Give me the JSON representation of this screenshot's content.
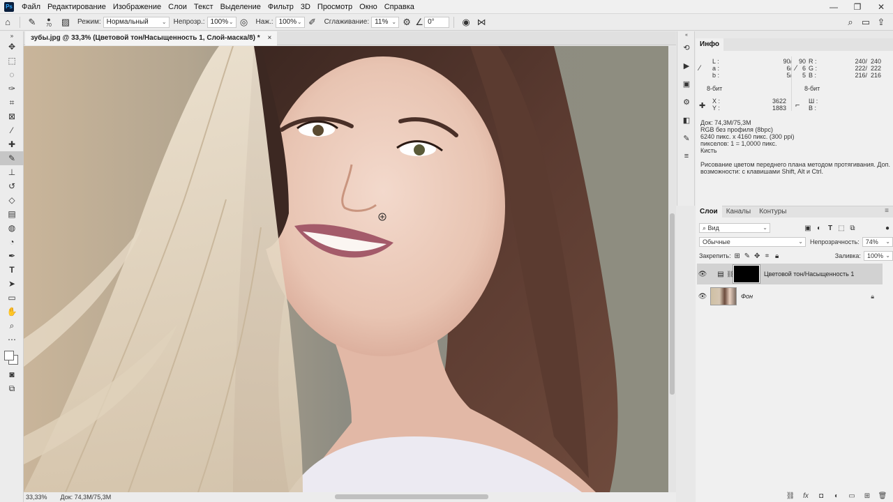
{
  "menubar": {
    "logo": "Ps",
    "items": [
      "Файл",
      "Редактирование",
      "Изображение",
      "Слои",
      "Текст",
      "Выделение",
      "Фильтр",
      "3D",
      "Просмотр",
      "Окно",
      "Справка"
    ],
    "window_controls": [
      "—",
      "❐",
      "✕"
    ]
  },
  "options": {
    "brush_size": "70",
    "mode_label": "Режим:",
    "mode_value": "Нормальный",
    "opacity_label": "Непрозр.:",
    "opacity_value": "100%",
    "pressure_label": "Наж.:",
    "pressure_value": "100%",
    "smoothing_label": "Сглаживание:",
    "smoothing_value": "11%",
    "angle_value": "0°"
  },
  "document": {
    "tab_title": "зубы.jpg @ 33,3% (Цветовой тон/Насыщенность 1, Слой-маска/8) *",
    "tab_close": "×"
  },
  "status": {
    "zoom": "33,33%",
    "doc": "Док: 74,3M/75,3M"
  },
  "info": {
    "tab": "Инфо",
    "lab": {
      "l": "L :",
      "a": "a :",
      "b": "b :",
      "l_v1": "90/",
      "l_v2": "90",
      "a_v1": "6/",
      "a_v2": "6",
      "b_v1": "5/",
      "b_v2": "5"
    },
    "rgb": {
      "r": "R :",
      "g": "G :",
      "b": "B :",
      "r_v1": "240/",
      "r_v2": "240",
      "g_v1": "222/",
      "g_v2": "222",
      "b_v1": "216/",
      "b_v2": "216"
    },
    "bits_left": "8-бит",
    "bits_right": "8-бит",
    "xy": {
      "x": "X :",
      "y": "Y :",
      "x_v": "3622",
      "y_v": "1883"
    },
    "wh": {
      "w": "Ш :",
      "h": "В :"
    },
    "doc_info": [
      "Док: 74,3M/75,3M",
      "RGB без профиля (8bpc)",
      "6240 пикс. x 4160 пикс. (300 ppi)",
      "пикселов: 1 = 1,0000 пикс.",
      "Кисть"
    ],
    "hint": [
      "Рисование цветом переднего плана методом протягивания. Доп.",
      "возможности: с клавишами Shift, Alt и Ctrl."
    ]
  },
  "layers": {
    "tabs": [
      "Слои",
      "Каналы",
      "Контуры"
    ],
    "filter_value": "Вид",
    "blend_mode": "Обычные",
    "opacity_label": "Непрозрачность:",
    "opacity_value": "74%",
    "lock_label": "Закрепить:",
    "fill_label": "Заливка:",
    "fill_value": "100%",
    "items": [
      {
        "name": "Цветовой тон/Насыщенность 1"
      },
      {
        "name": "Фон"
      }
    ]
  }
}
